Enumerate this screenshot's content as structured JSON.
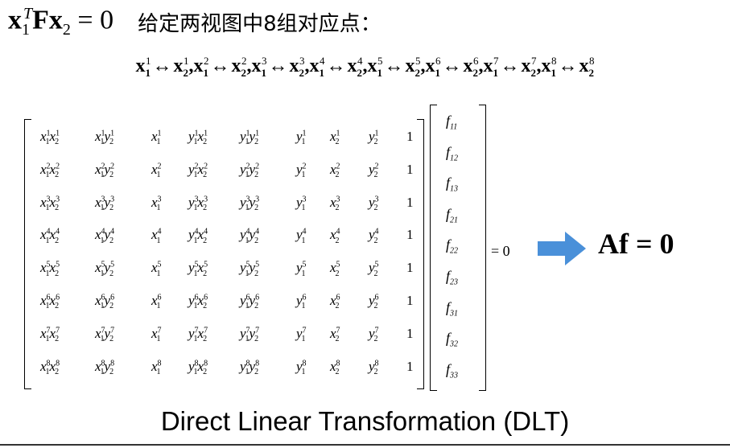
{
  "header": {
    "equation": {
      "x": "x",
      "sub1": "1",
      "sup_t": "T",
      "F": "F",
      "x2": "x",
      "sub2": "2",
      "eq": "= 0"
    },
    "description": "给定两视图中8组对应点："
  },
  "correspondences": [
    {
      "index": "1"
    },
    {
      "index": "2"
    },
    {
      "index": "3"
    },
    {
      "index": "4"
    },
    {
      "index": "5"
    },
    {
      "index": "6"
    },
    {
      "index": "7"
    },
    {
      "index": "8"
    }
  ],
  "correspondence_symbols": {
    "arrow": "↔",
    "sep": ",",
    "x": "x",
    "view1": "1",
    "view2": "2"
  },
  "matrix_a": {
    "rows": [
      "1",
      "2",
      "3",
      "4",
      "5",
      "6",
      "7",
      "8"
    ],
    "one": "1"
  },
  "vector_f": [
    "11",
    "12",
    "13",
    "21",
    "22",
    "23",
    "31",
    "32",
    "33"
  ],
  "f_symbol": "f",
  "equals_zero": "= 0",
  "result_equation": "Af = 0",
  "caption": "Direct Linear Transformation (DLT)",
  "colors": {
    "arrow": "#4a90d9",
    "text": "#000000",
    "rule": "#333333"
  },
  "icons": {
    "arrow": "right-arrow-icon"
  }
}
